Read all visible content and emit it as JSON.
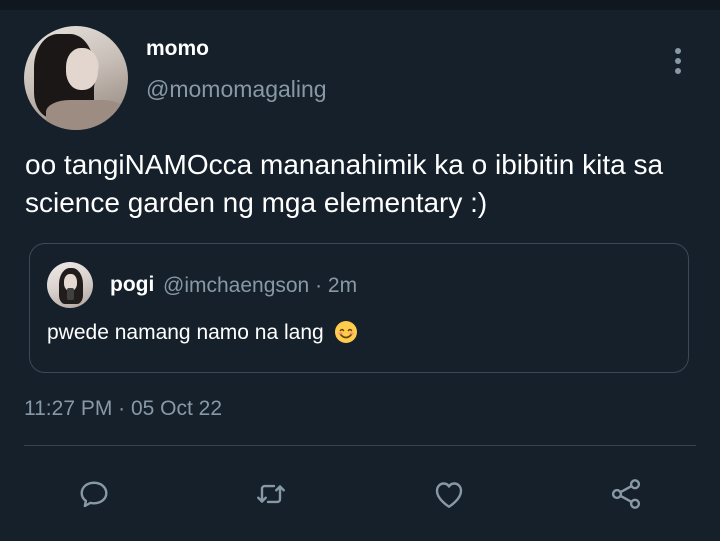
{
  "tweet": {
    "author": {
      "display_name": "momo",
      "handle": "@momomagaling"
    },
    "text": "oo tangiNAMOcca mananahimik ka o ibibitin kita sa science garden ng mga elementary :)",
    "timestamp": "11:27 PM · 05 Oct 22"
  },
  "quoted_tweet": {
    "author": {
      "display_name": "pogi",
      "handle": "@imchaengson"
    },
    "meta": "@imchaengson · 2m",
    "text": "pwede namang namo na lang",
    "emoji": "smiling-face-with-smiling-eyes"
  },
  "icons": {
    "more": "more-vertical-icon",
    "reply": "reply-icon",
    "retweet": "retweet-icon",
    "like": "heart-icon",
    "share": "share-icon"
  },
  "colors": {
    "background": "#15202b",
    "secondary_text": "#8899a6",
    "border": "#38444d"
  }
}
